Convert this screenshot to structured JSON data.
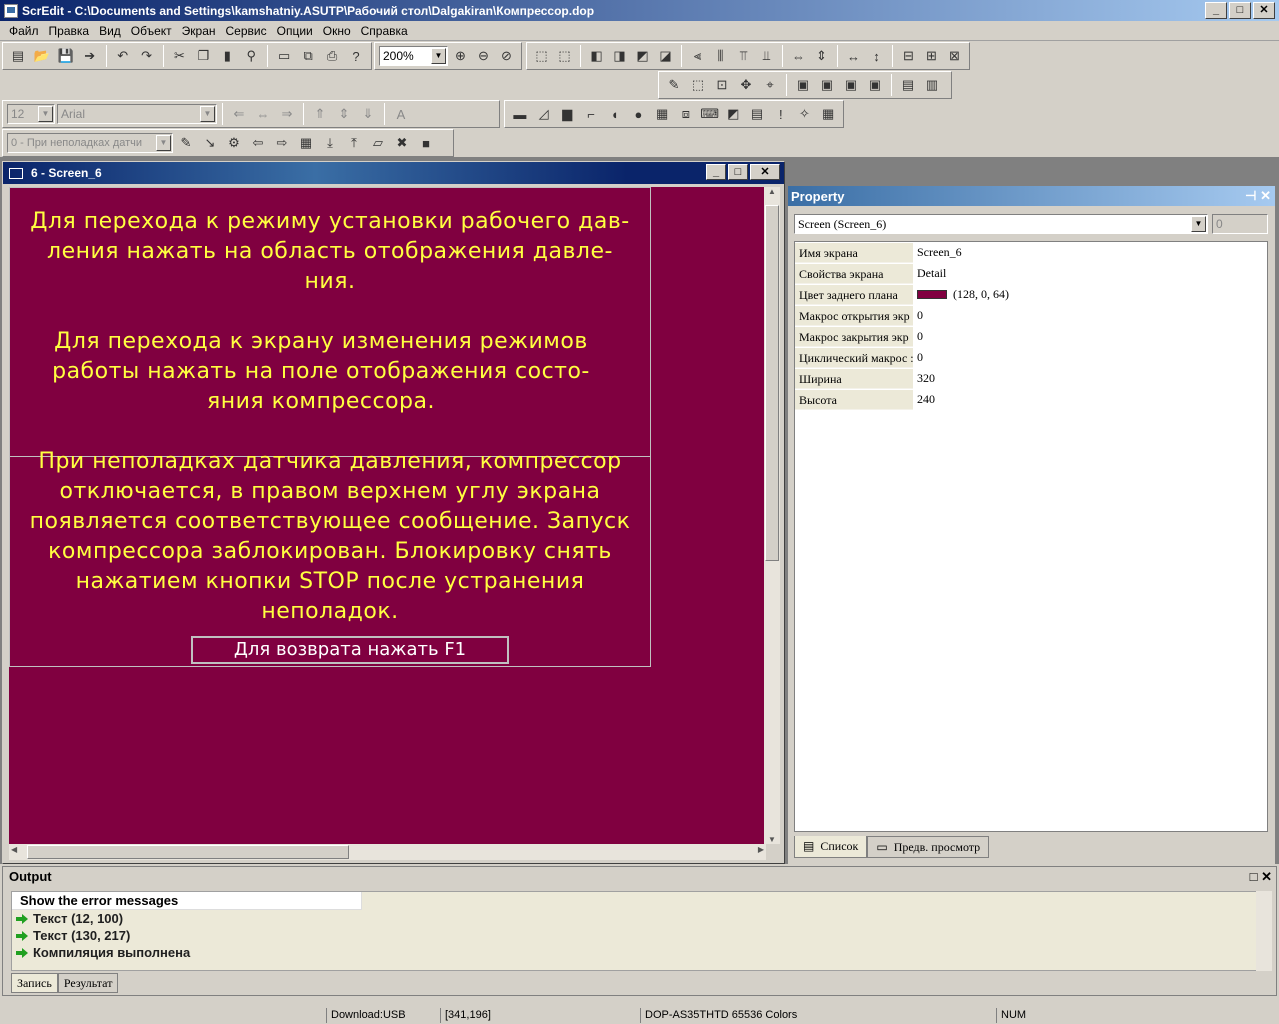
{
  "app": {
    "title": "ScrEdit - C:\\Documents and Settings\\kamshatniy.ASUTP\\Рабочий стол\\Dalgakiran\\Компрессор.dop",
    "window_buttons": [
      "_",
      "□",
      "✕"
    ]
  },
  "menu": [
    "Файл",
    "Правка",
    "Вид",
    "Объект",
    "Экран",
    "Сервис",
    "Опции",
    "Окно",
    "Справка"
  ],
  "toolbar": {
    "zoom": "200%",
    "font_size": "12",
    "font_name": "Arial",
    "screen_select": "0 - При неполадках датчи"
  },
  "editor": {
    "title": "6 - Screen_6",
    "text1": [
      "Для перехода к режиму установки рабочего дав-",
      "ления нажать на область отображения  давле-",
      "ния."
    ],
    "text2": [
      "Для перехода к экрану изменения режимов",
      "работы нажать на поле отображения  состо-",
      "яния  компрессора."
    ],
    "text3": [
      "При неполадках датчика давления, компрессор",
      "отключается, в правом верхнем углу экрана",
      "появляется соответствующее сообщение. Запуск",
      "компрессора заблокирован. Блокировку снять",
      "нажатием кнопки STOP после устранения",
      "неполадок."
    ],
    "button_text": "Для возврата нажать F1",
    "background_color": "#800040",
    "text_color": "#ffff40"
  },
  "property": {
    "title": "Property",
    "object_select": "Screen (Screen_6)",
    "index": "0",
    "rows": [
      {
        "key": "Имя экрана",
        "value": "Screen_6"
      },
      {
        "key": "Свойства экрана",
        "value": "Detail"
      },
      {
        "key": "Цвет заднего плана",
        "value": "(128, 0, 64)"
      },
      {
        "key": "Макрос открытия экр",
        "value": "0"
      },
      {
        "key": "Макрос закрытия экр",
        "value": "0"
      },
      {
        "key": "Циклический макрос :",
        "value": "0"
      },
      {
        "key": "Ширина",
        "value": "320"
      },
      {
        "key": "Высота",
        "value": "240"
      }
    ],
    "tabs": [
      "Список",
      "Предв. просмотр"
    ]
  },
  "output": {
    "title": "Output",
    "column": "Show the error messages",
    "lines": [
      "Текст (12, 100)",
      "Текст (130, 217)",
      "Компиляция выполнена"
    ],
    "tabs": [
      "Запись",
      "Результат"
    ]
  },
  "status": {
    "download": "Download:USB",
    "coords": "[341,196]",
    "device": "DOP-AS35THTD 65536 Colors",
    "num": "NUM"
  }
}
